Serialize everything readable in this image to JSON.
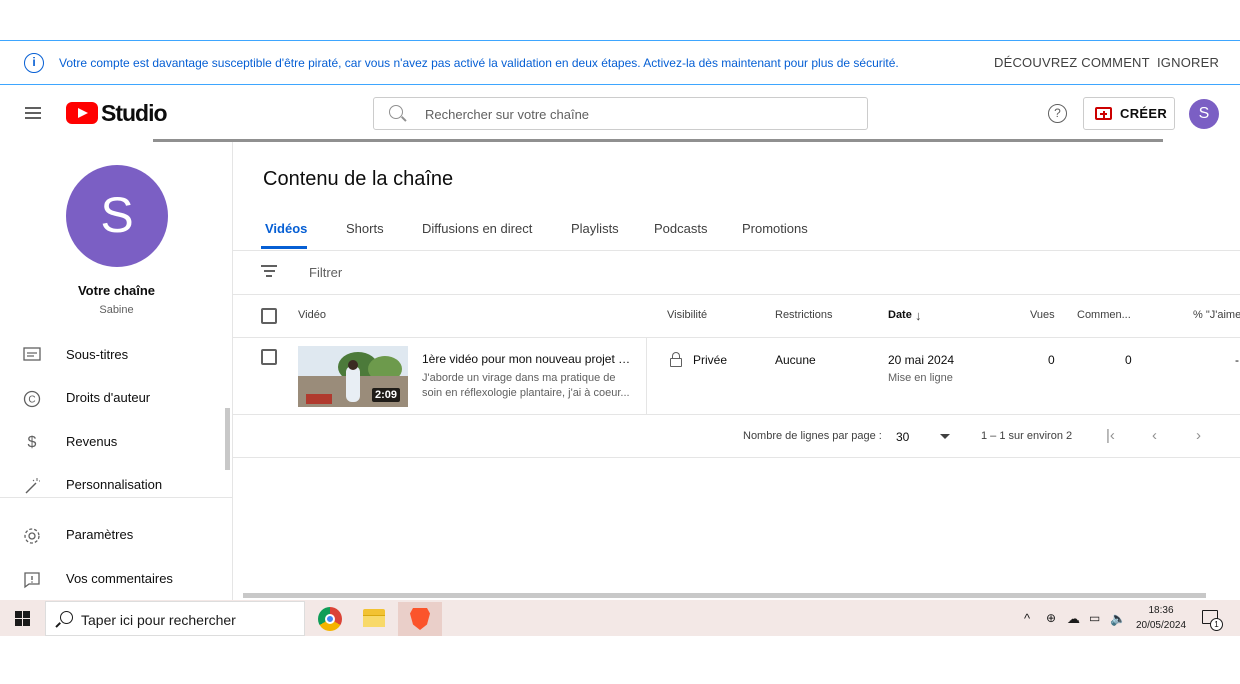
{
  "banner": {
    "message": "Votre compte est davantage susceptible d'être piraté, car vous n'avez pas activé la validation en deux étapes. Activez-la dès maintenant pour plus de sécurité.",
    "discover": "DÉCOUVREZ COMMENT",
    "ignore": "IGNORER",
    "info_icon": "i"
  },
  "header": {
    "logo_text": "Studio",
    "search_placeholder": "Rechercher sur votre chaîne",
    "help_icon": "?",
    "create_label": "CRÉER",
    "avatar_letter": "S"
  },
  "sidebar": {
    "avatar_letter": "S",
    "channel_title": "Votre chaîne",
    "channel_name": "Sabine",
    "items": [
      {
        "label": "Sous-titres",
        "icon": "subtitles-icon"
      },
      {
        "label": "Droits d'auteur",
        "icon": "copyright-icon"
      },
      {
        "label": "Revenus",
        "icon": "dollar-icon"
      },
      {
        "label": "Personnalisation",
        "icon": "magic-wand-icon"
      },
      {
        "label": "Paramètres",
        "icon": "gear-icon"
      },
      {
        "label": "Vos commentaires",
        "icon": "feedback-icon"
      }
    ]
  },
  "main": {
    "title": "Contenu de la chaîne",
    "tabs": [
      "Vidéos",
      "Shorts",
      "Diffusions en direct",
      "Playlists",
      "Podcasts",
      "Promotions"
    ],
    "filter_label": "Filtrer",
    "columns": {
      "video": "Vidéo",
      "visibility": "Visibilité",
      "restrictions": "Restrictions",
      "date": "Date",
      "views": "Vues",
      "comments": "Commen...",
      "likes": "% \"J'aime"
    },
    "rows": [
      {
        "duration": "2:09",
        "title": "1ère vidéo pour mon nouveau projet \"...",
        "description": "J'aborde un virage dans ma pratique de soin en réflexologie plantaire, j'ai à coeur...",
        "visibility": "Privée",
        "restrictions": "Aucune",
        "date": "20 mai 2024",
        "date_status": "Mise en ligne",
        "views": "0",
        "comments": "0",
        "likes": "-"
      }
    ],
    "pagination": {
      "rows_label": "Nombre de lignes par page :",
      "rows_value": "30",
      "range": "1 – 1 sur environ 2"
    }
  },
  "taskbar": {
    "search_placeholder": "Taper ici pour rechercher",
    "time": "18:36",
    "date": "20/05/2024",
    "notification_count": "1"
  }
}
